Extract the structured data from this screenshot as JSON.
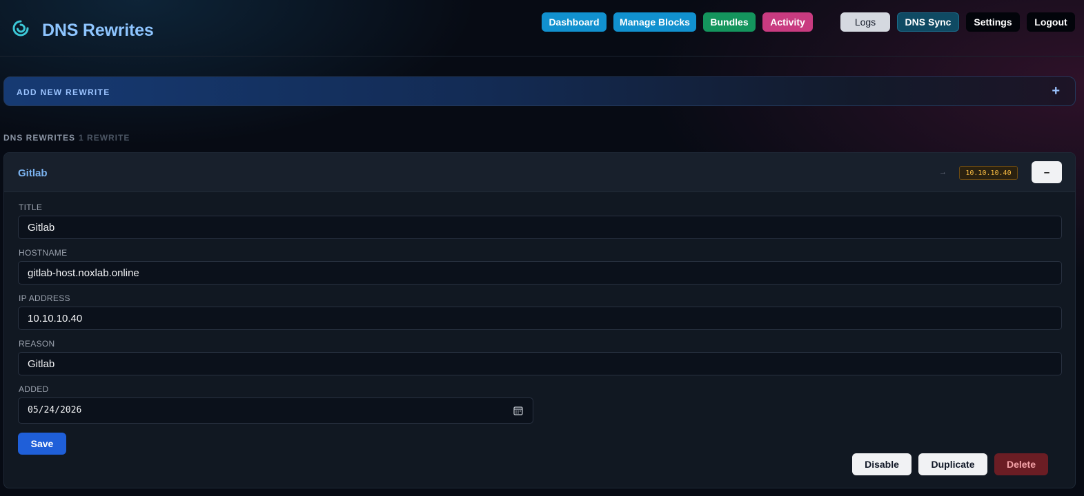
{
  "app": {
    "title": "DNS Rewrites",
    "logo_icon": "spiral-logo-icon"
  },
  "nav": {
    "dashboard": "Dashboard",
    "manage_blocks": "Manage Blocks",
    "bundles": "Bundles",
    "activity": "Activity",
    "logs": "Logs",
    "dns_sync": "DNS Sync",
    "settings": "Settings",
    "logout": "Logout"
  },
  "add_bar": {
    "label": "ADD NEW REWRITE",
    "toggle": "+"
  },
  "section": {
    "title": "DNS REWRITES",
    "count": "1 REWRITE"
  },
  "rewrite": {
    "title": "Gitlab",
    "arrow": "→",
    "ip_badge": "10.10.10.40",
    "collapse": "–",
    "fields": {
      "title_label": "TITLE",
      "title_value": "Gitlab",
      "hostname_label": "HOSTNAME",
      "hostname_value": "gitlab-host.noxlab.online",
      "ip_label": "IP ADDRESS",
      "ip_value": "10.10.10.40",
      "reason_label": "REASON",
      "reason_value": "Gitlab",
      "added_label": "ADDED",
      "added_value": "05/24/2026"
    },
    "actions": {
      "save": "Save",
      "disable": "Disable",
      "duplicate": "Duplicate",
      "delete": "Delete"
    }
  },
  "colors": {
    "accent_blue": "#1191cf",
    "bundles_green": "#14955d",
    "activity_pink": "#c93b80",
    "save_blue": "#1f5fd9",
    "delete_red": "#6b1d24",
    "ip_badge_amber": "#f5b942"
  }
}
